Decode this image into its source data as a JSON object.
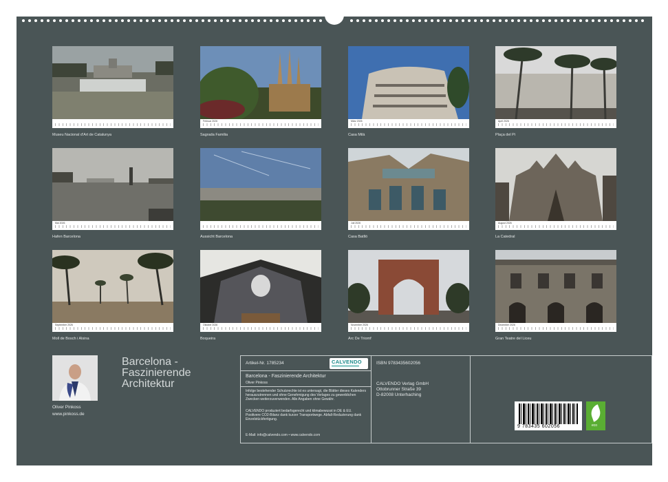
{
  "grid": [
    {
      "id": "t1",
      "month": "",
      "caption": "Museu Nacional d'Art de Catalunya",
      "strip": true
    },
    {
      "id": "t2",
      "month": "Februar 2026",
      "caption": "Sagrada Familia",
      "strip": true
    },
    {
      "id": "t3",
      "month": "März 2026",
      "caption": "Casa Milà",
      "strip": true
    },
    {
      "id": "t4",
      "month": "April 2026",
      "caption": "Plaça del Pi",
      "strip": true
    },
    {
      "id": "t5",
      "month": "Mai 2026",
      "caption": "Hafen Barcelona",
      "strip": true
    },
    {
      "id": "t6",
      "month": "",
      "caption": "Aussicht Barcelona",
      "strip": true
    },
    {
      "id": "t7",
      "month": "Juli 2026",
      "caption": "Casa Batlló",
      "strip": true
    },
    {
      "id": "t8",
      "month": "August 2026",
      "caption": "La Catedral",
      "strip": true
    },
    {
      "id": "t9",
      "month": "September 2026",
      "caption": "Moll de Bosch i Alsina",
      "strip": true
    },
    {
      "id": "t10",
      "month": "Oktober 2026",
      "caption": "Boqueira",
      "strip": true
    },
    {
      "id": "t11",
      "month": "November 2026",
      "caption": "Arc De Triomf",
      "strip": true
    },
    {
      "id": "t12",
      "month": "Dezember 2026",
      "caption": "Gran Teatre del Liceu",
      "strip": true
    }
  ],
  "author": {
    "name": "Oliver Pinkoss",
    "website": "www.pinkoss.de"
  },
  "cover_title": "Barcelona - Faszinierende Architektur",
  "info": {
    "article": "Artikel-Nr. 1785234",
    "logo": "CALVENDO",
    "isbn": "ISBN 9783435602056",
    "title": "Barcelona - Faszinierende Architektur",
    "author": "Oliver Pinkoss",
    "publisher_name": "CALVENDO Verlag GmbH",
    "publisher_street": "Ottobrunner Straße 39",
    "publisher_city": "D-82008 Unterhaching",
    "legal": "Infolge bestehender Schutzrechte ist es untersagt, die Blätter dieses Kalenders herauszutrennen und ohne Genehmigung des Verlages zu gewerblichen Zwecken weiterzuverwenden. Alle Angaben ohne Gewähr.",
    "eco_text": "CALVENDO produziert bedarfsgerecht und klimabewusst in DE & EU. Positivere CO2-Bilanz dank kurzer Transportwege. Abfall-Reduzierung dank Einzelstückfertigung.",
    "contact": "E-Mail: info@calvendo.com • www.calvendo.com",
    "barcode_number": "9 783435 602056",
    "eco_label": "eco"
  },
  "colors": {
    "board": "#4a5556",
    "text": "#e6e9e9",
    "eco": "#5aae33",
    "logo": "#1b8a8a"
  }
}
